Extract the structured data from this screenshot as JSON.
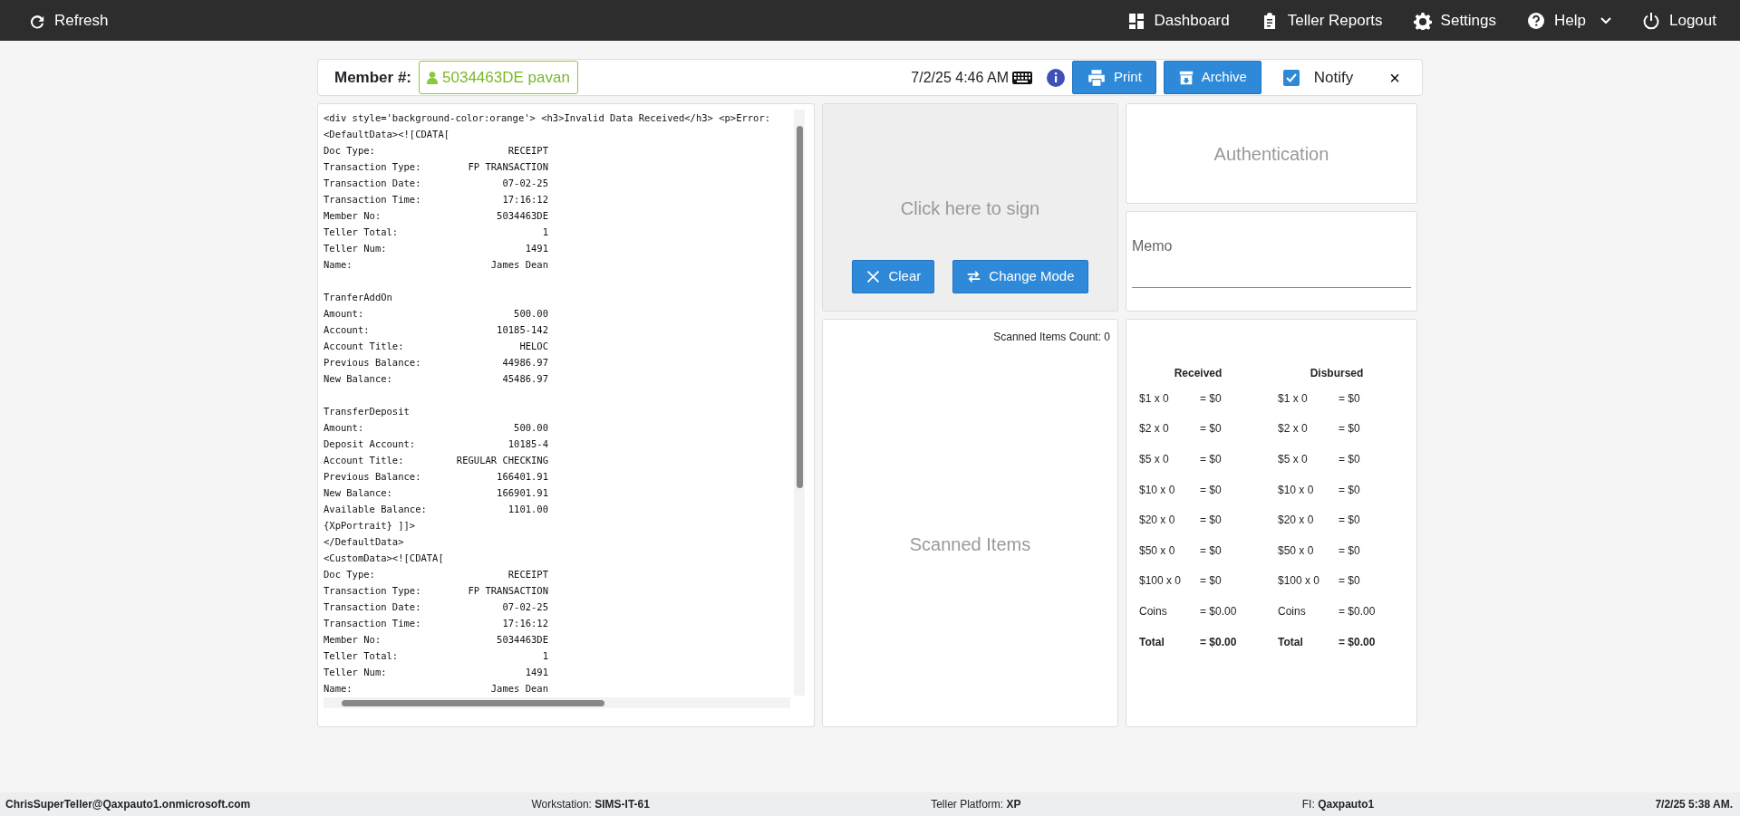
{
  "navbar": {
    "left": [
      {
        "label": "Refresh"
      }
    ],
    "right": [
      {
        "label": "Dashboard"
      },
      {
        "label": "Teller Reports"
      },
      {
        "label": "Settings"
      },
      {
        "label": "Help"
      },
      {
        "label": "Logout"
      }
    ]
  },
  "header": {
    "member_label": "Member #:",
    "member_value": "5034463DE pavan",
    "datetime": "7/2/25 4:46 AM",
    "buttons": [
      {
        "label": "Print"
      },
      {
        "label": "Archive"
      }
    ],
    "notify": {
      "label": "Notify",
      "checked": true
    },
    "close": "×"
  },
  "receipt": {
    "sections": [
      [
        {
          "text": "<div style='background-color:orange'> <h3>Invalid Data Received</h3> <p>Error:"
        },
        {
          "text": "<DefaultData><![CDATA["
        },
        {
          "label": "Doc Type:",
          "value": "RECEIPT"
        },
        {
          "label": "Transaction Type:",
          "value": "FP TRANSACTION"
        },
        {
          "label": "Transaction Date:",
          "value": "07-02-25"
        },
        {
          "label": "Transaction Time:",
          "value": "17:16:12"
        },
        {
          "label": "Member No:",
          "value": "5034463DE"
        },
        {
          "label": "Teller Total:",
          "value": "1"
        },
        {
          "label": "Teller Num:",
          "value": "1491"
        },
        {
          "label": "Name:",
          "value": "James Dean"
        }
      ],
      [
        {
          "text": "TranferAddOn"
        },
        {
          "label": "Amount:",
          "value": "500.00"
        },
        {
          "label": "Account:",
          "value": "10185-142"
        },
        {
          "label": "Account Title:",
          "value": "HELOC"
        },
        {
          "label": "Previous Balance:",
          "value": "44986.97"
        },
        {
          "label": "New Balance:",
          "value": "45486.97"
        }
      ],
      [
        {
          "text": "TransferDeposit"
        },
        {
          "label": "Amount:",
          "value": "500.00"
        },
        {
          "label": "Deposit Account:",
          "value": "10185-4"
        },
        {
          "label": "Account Title:",
          "value": "REGULAR CHECKING"
        },
        {
          "label": "Previous Balance:",
          "value": "166401.91"
        },
        {
          "label": "New Balance:",
          "value": "166901.91"
        },
        {
          "label": "Available Balance:",
          "value": "1101.00"
        },
        {
          "text": "{XpPortrait} ]]>"
        },
        {
          "text": "</DefaultData>"
        },
        {
          "text": "<CustomData><![CDATA["
        },
        {
          "label": "Doc Type:",
          "value": "RECEIPT"
        },
        {
          "label": "Transaction Type:",
          "value": "FP TRANSACTION"
        },
        {
          "label": "Transaction Date:",
          "value": "07-02-25"
        },
        {
          "label": "Transaction Time:",
          "value": "17:16:12"
        },
        {
          "label": "Member No:",
          "value": "5034463DE"
        },
        {
          "label": "Teller Total:",
          "value": "1"
        },
        {
          "label": "Teller Num:",
          "value": "1491"
        },
        {
          "label": "Name:",
          "value": "James Dean"
        }
      ]
    ]
  },
  "signature": {
    "prompt": "Click here to sign",
    "buttons": [
      {
        "label": "Clear"
      },
      {
        "label": "Change Mode"
      }
    ]
  },
  "scanned": {
    "count": "Scanned Items Count: 0",
    "title": "Scanned Items"
  },
  "authentication": {
    "title": "Authentication"
  },
  "memo": {
    "label": "Memo"
  },
  "cash": {
    "columns": [
      {
        "heading": "Received",
        "rows": [
          {
            "item": "$1 x 0",
            "amount": "= $0"
          },
          {
            "item": "$2 x 0",
            "amount": "= $0"
          },
          {
            "item": "$5 x 0",
            "amount": "= $0"
          },
          {
            "item": "$10 x 0",
            "amount": "= $0"
          },
          {
            "item": "$20 x 0",
            "amount": "= $0"
          },
          {
            "item": "$50 x 0",
            "amount": "= $0"
          },
          {
            "item": "$100 x 0",
            "amount": "= $0"
          },
          {
            "item": "Coins",
            "amount": "= $0.00"
          },
          {
            "item": "Total",
            "amount": "= $0.00",
            "total": true
          }
        ]
      },
      {
        "heading": "Disbursed",
        "rows": [
          {
            "item": "$1 x 0",
            "amount": "= $0"
          },
          {
            "item": "$2 x 0",
            "amount": "= $0"
          },
          {
            "item": "$5 x 0",
            "amount": "= $0"
          },
          {
            "item": "$10 x 0",
            "amount": "= $0"
          },
          {
            "item": "$20 x 0",
            "amount": "= $0"
          },
          {
            "item": "$50 x 0",
            "amount": "= $0"
          },
          {
            "item": "$100 x 0",
            "amount": "= $0"
          },
          {
            "item": "Coins",
            "amount": "= $0.00"
          },
          {
            "item": "Total",
            "amount": "= $0.00",
            "total": true
          }
        ]
      }
    ]
  },
  "status_bar": [
    {
      "value": "ChrisSuperTeller@Qaxpauto1.onmicrosoft.com"
    },
    {
      "label": "Workstation:",
      "value": "SIMS-IT-61"
    },
    {
      "label": "Teller Platform:",
      "value": "XP"
    },
    {
      "label": "FI:",
      "value": "Qaxpauto1"
    },
    {
      "value": "7/2/25 5:38 AM."
    }
  ]
}
